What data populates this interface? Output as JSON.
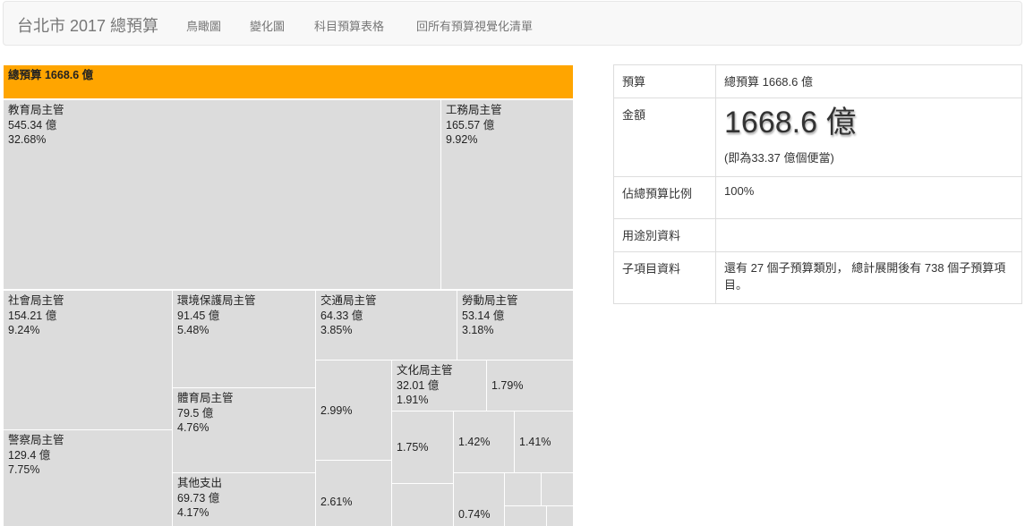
{
  "nav": {
    "brand": "台北市 2017 總預算",
    "links": [
      "鳥瞰圖",
      "變化圖",
      "科目預算表格",
      "回所有預算視覺化清單"
    ]
  },
  "treemap": {
    "root": "總預算 1668.6 億",
    "cells": [
      {
        "name": "教育局主管",
        "amount": "545.34 億",
        "pct": "32.68%"
      },
      {
        "name": "工務局主管",
        "amount": "165.57 億",
        "pct": "9.92%"
      },
      {
        "name": "社會局主管",
        "amount": "154.21 億",
        "pct": "9.24%"
      },
      {
        "name": "警察局主管",
        "amount": "129.4 億",
        "pct": "7.75%"
      },
      {
        "name": "環境保護局主管",
        "amount": "91.45 億",
        "pct": "5.48%"
      },
      {
        "name": "體育局主管",
        "amount": "79.5 億",
        "pct": "4.76%"
      },
      {
        "name": "其他支出",
        "amount": "69.73 億",
        "pct": "4.17%"
      },
      {
        "name": "交通局主管",
        "amount": "64.33 億",
        "pct": "3.85%"
      },
      {
        "name": "勞動局主管",
        "amount": "53.14 億",
        "pct": "3.18%"
      },
      {
        "name": "",
        "amount": "",
        "pct": "2.99%"
      },
      {
        "name": "",
        "amount": "",
        "pct": "2.61%"
      },
      {
        "name": "文化局主管",
        "amount": "32.01 億",
        "pct": "1.91%"
      },
      {
        "name": "",
        "amount": "",
        "pct": "1.79%"
      },
      {
        "name": "",
        "amount": "",
        "pct": "1.75%"
      },
      {
        "name": "",
        "amount": "",
        "pct": "1.42%"
      },
      {
        "name": "",
        "amount": "",
        "pct": "1.41%"
      },
      {
        "name": "",
        "amount": "",
        "pct": "0.74%"
      }
    ]
  },
  "info": {
    "rows": [
      {
        "key": "預算",
        "value": "總預算 1668.6 億"
      },
      {
        "key": "金額",
        "value": "1668.6 億",
        "note": "(即為33.37 億個便當)"
      },
      {
        "key": "佔總預算比例",
        "value": "100%"
      },
      {
        "key": "用途別資料",
        "value": ""
      },
      {
        "key": "子項目資料",
        "value": "還有 27 個子預算類別， 總計展開後有 738 個子預算項目。"
      }
    ]
  }
}
